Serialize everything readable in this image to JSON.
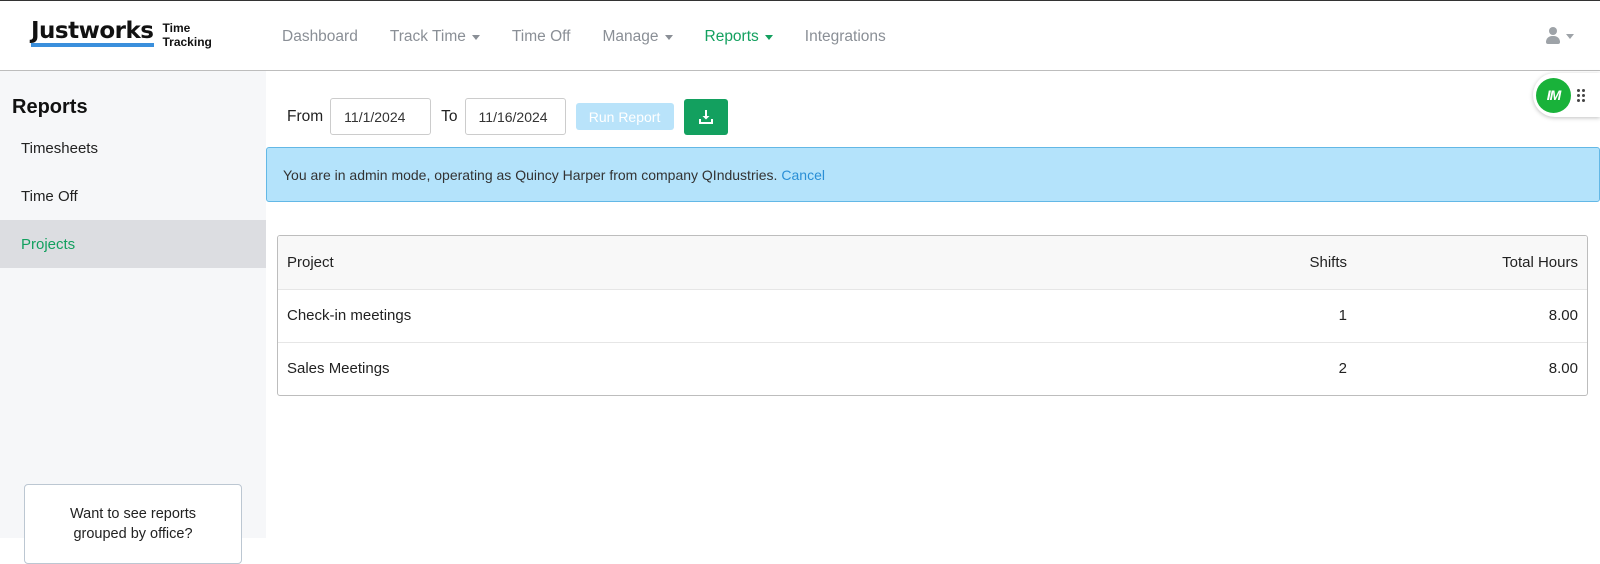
{
  "header": {
    "logo_word": "Justworks",
    "logo_sub_1": "Time",
    "logo_sub_2": "Tracking",
    "accent_color": "#13a05f",
    "nav": [
      {
        "label": "Dashboard",
        "dropdown": false,
        "active": false
      },
      {
        "label": "Track Time",
        "dropdown": true,
        "active": false
      },
      {
        "label": "Time Off",
        "dropdown": false,
        "active": false
      },
      {
        "label": "Manage",
        "dropdown": true,
        "active": false
      },
      {
        "label": "Reports",
        "dropdown": true,
        "active": true
      },
      {
        "label": "Integrations",
        "dropdown": false,
        "active": false
      }
    ],
    "user_icon": "user-icon"
  },
  "sidebar": {
    "title": "Reports",
    "items": [
      {
        "label": "Timesheets",
        "active": false
      },
      {
        "label": "Time Off",
        "active": false
      },
      {
        "label": "Projects",
        "active": true
      }
    ],
    "office_prompt_line1": "Want to see reports",
    "office_prompt_line2": "grouped by office?"
  },
  "filters": {
    "from_label": "From",
    "from_value": "11/1/2024",
    "to_label": "To",
    "to_value": "11/16/2024",
    "run_label": "Run Report",
    "download_icon": "download-icon"
  },
  "alert": {
    "message": "You are in admin mode, operating as Quincy Harper from company QIndustries.",
    "cancel_label": "Cancel"
  },
  "table": {
    "headers": [
      "Project",
      "Shifts",
      "Total Hours"
    ],
    "rows": [
      [
        "Check-in meetings",
        "1",
        "8.00"
      ],
      [
        "Sales Meetings",
        "2",
        "8.00"
      ]
    ]
  },
  "widget": {
    "badge": "IM",
    "icon": "grip-icon"
  }
}
